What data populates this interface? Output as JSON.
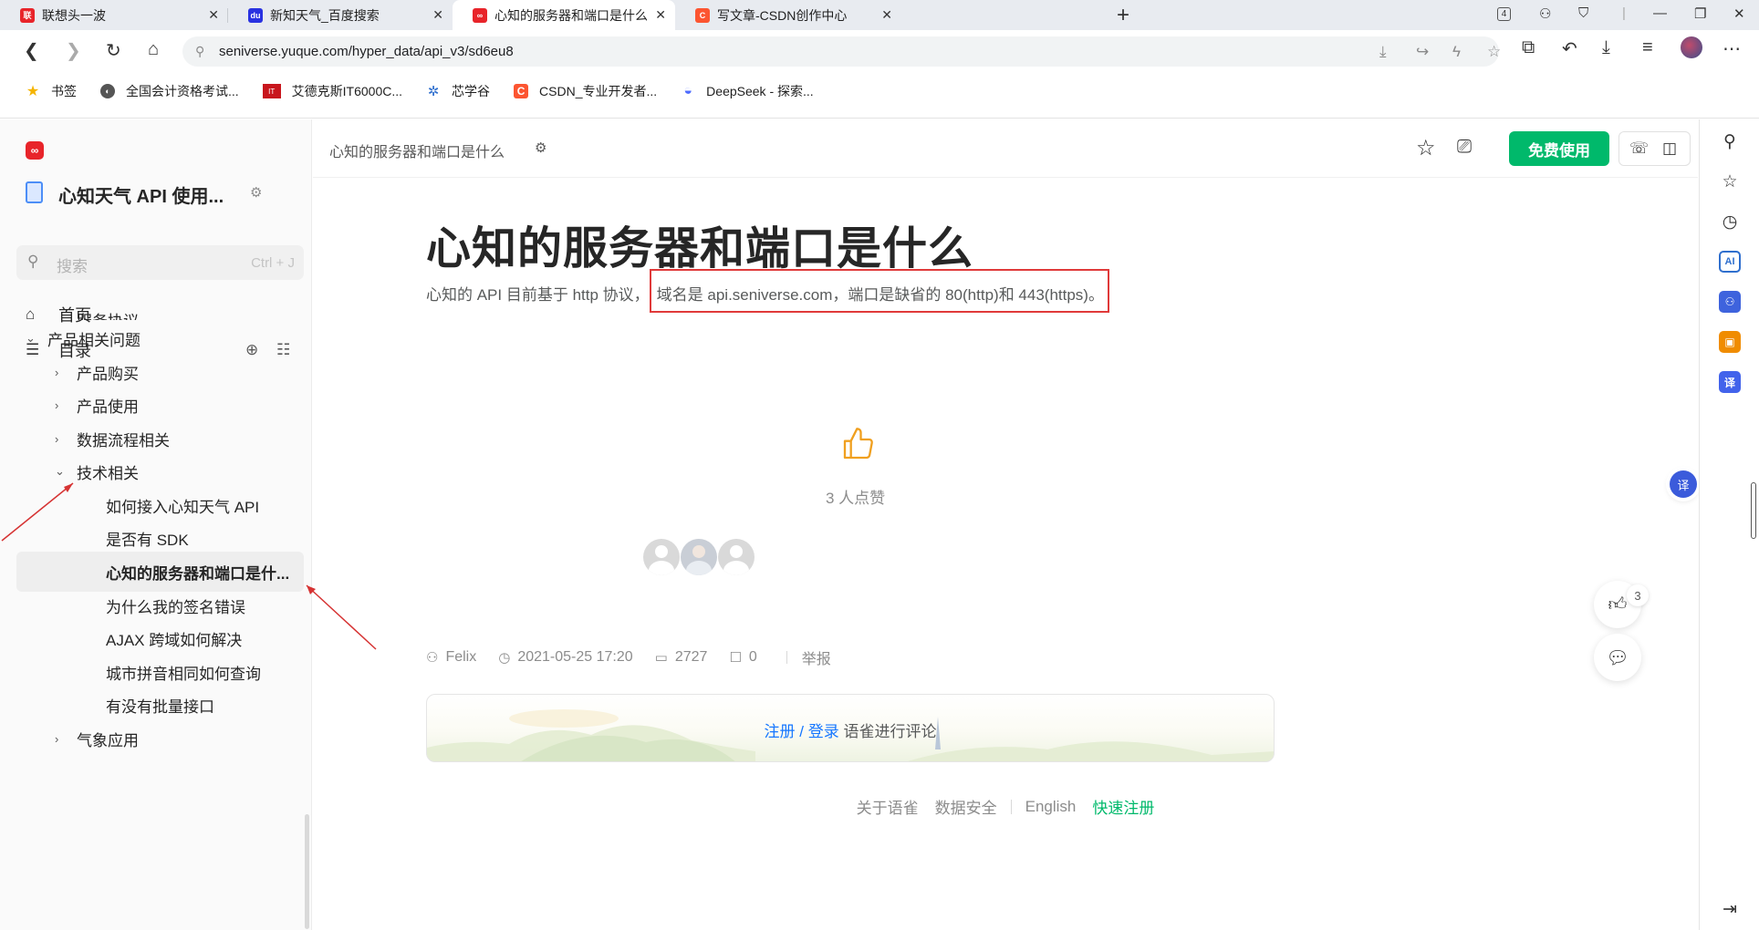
{
  "browser": {
    "tabs": [
      {
        "title": "联想头一波",
        "icon": "lenovo-icon",
        "color": "#e8242a"
      },
      {
        "title": "新知天气_百度搜索",
        "icon": "baidu-icon",
        "color": "#2932e1"
      },
      {
        "title": "心知的服务器和端口是什么",
        "icon": "yuque-icon",
        "color": "#e8242a",
        "active": true
      },
      {
        "title": "写文章-CSDN创作中心",
        "icon": "csdn-icon",
        "color": "#fc5531"
      }
    ],
    "tab_count_badge": "4",
    "url": "seniverse.yuque.com/hyper_data/api_v3/sd6eu8",
    "bookmarks": [
      {
        "label": "书签",
        "icon": "star-icon"
      },
      {
        "label": "全国会计资格考试...",
        "icon": "accounting-icon"
      },
      {
        "label": "艾德克斯IT6000C...",
        "icon": "itech-icon"
      },
      {
        "label": "芯学谷",
        "icon": "xinxuegu-icon"
      },
      {
        "label": "CSDN_专业开发者...",
        "icon": "csdn-icon"
      },
      {
        "label": "DeepSeek - 探索...",
        "icon": "deepseek-icon"
      }
    ]
  },
  "sidebar": {
    "book_title": "心知天气 API 使用...",
    "search_placeholder": "搜索",
    "search_shortcut": "Ctrl + J",
    "nav": [
      {
        "label": "首页",
        "icon": "home-icon"
      },
      {
        "label": "目录",
        "icon": "toc-icon"
      }
    ],
    "toc": [
      {
        "label": "服务协议",
        "level": 2,
        "clipped": true
      },
      {
        "label": "产品相关问题",
        "level": 1,
        "expanded": true
      },
      {
        "label": "产品购买",
        "level": 2,
        "expanded": false
      },
      {
        "label": "产品使用",
        "level": 2,
        "expanded": false
      },
      {
        "label": "数据流程相关",
        "level": 2,
        "expanded": false
      },
      {
        "label": "技术相关",
        "level": 2,
        "expanded": true
      },
      {
        "label": "如何接入心知天气 API",
        "level": 3
      },
      {
        "label": "是否有 SDK",
        "level": 3
      },
      {
        "label": "心知的服务器和端口是什...",
        "level": 3,
        "selected": true
      },
      {
        "label": "为什么我的签名错误",
        "level": 3
      },
      {
        "label": "AJAX 跨域如何解决",
        "level": 3
      },
      {
        "label": "城市拼音相同如何查询",
        "level": 3
      },
      {
        "label": "有没有批量接口",
        "level": 3
      },
      {
        "label": "气象应用",
        "level": 2,
        "expanded": false
      }
    ]
  },
  "doc": {
    "breadcrumb": "心知的服务器和端口是什么",
    "free_button": "免费使用",
    "title": "心知的服务器和端口是什么",
    "para_prefix": "心知的 API 目前基于 http 协议，",
    "para_highlight": "域名是 api.seniverse.com，端口是缺省的 80(http)和 443(https)。",
    "like_text": "3 人点赞",
    "author": "Felix",
    "date": "2021-05-25 17:20",
    "reads": "2727",
    "comments": "0",
    "report": "举报",
    "comment_register": "注册",
    "comment_slash": " / ",
    "comment_login": "登录",
    "comment_suffix": " 语雀进行评论",
    "like_badge": "3"
  },
  "footer": {
    "about": "关于语雀",
    "security": "数据安全",
    "english": "English",
    "register": "快速注册"
  },
  "colors": {
    "brand_green": "#00b96b",
    "annotation_red": "#e03a3a",
    "link_blue": "#1677ff"
  }
}
